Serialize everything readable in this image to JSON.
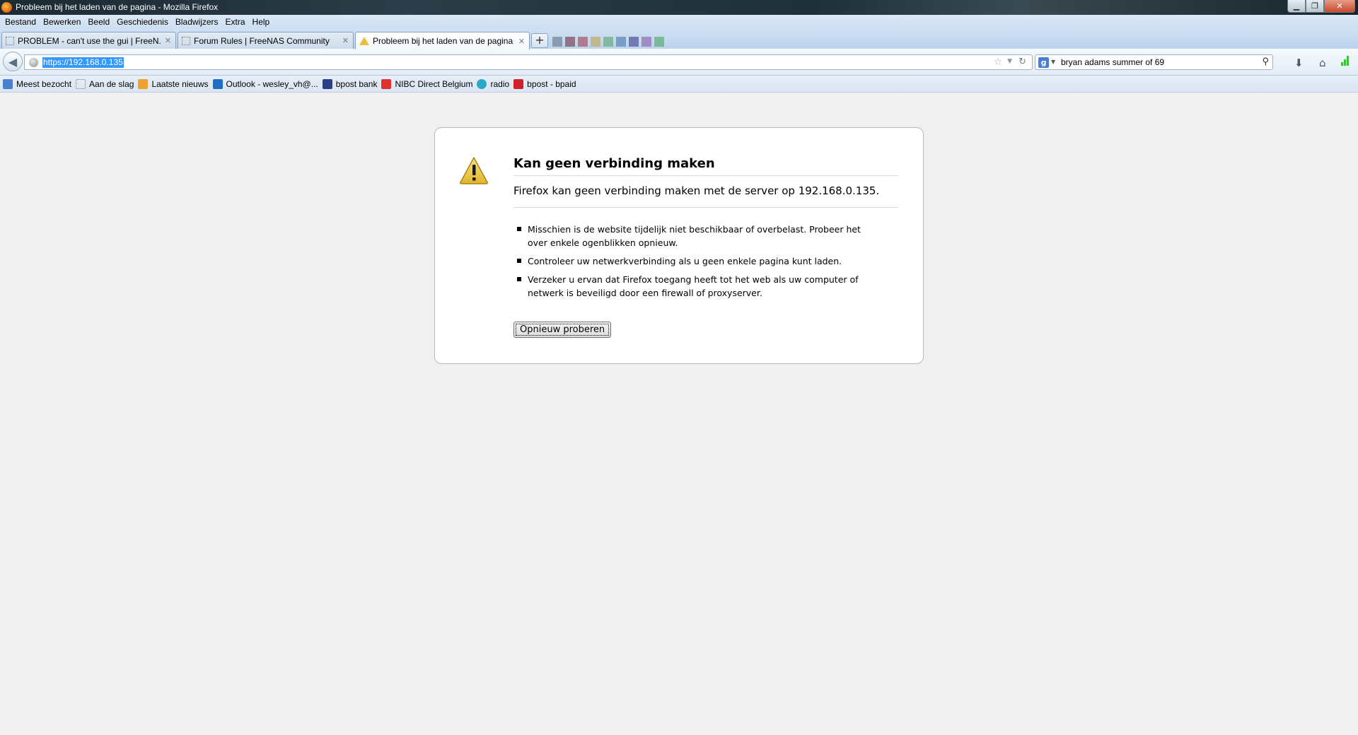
{
  "window": {
    "title": "Probleem bij het laden van de pagina - Mozilla Firefox"
  },
  "menubar": {
    "items": [
      "Bestand",
      "Bewerken",
      "Beeld",
      "Geschiedenis",
      "Bladwijzers",
      "Extra",
      "Help"
    ]
  },
  "tabs": [
    {
      "label": "PROBLEM - can't use the gui | FreeN...",
      "active": false
    },
    {
      "label": "Forum Rules | FreeNAS Community",
      "active": false
    },
    {
      "label": "Probleem bij het laden van de pagina",
      "active": true
    }
  ],
  "navbar": {
    "url": "https://192.168.0.135",
    "search_query": "bryan adams summer of 69"
  },
  "bookmarks": [
    {
      "label": "Meest bezocht",
      "icon": "most-visited-icon",
      "color": "#4a7fcf"
    },
    {
      "label": "Aan de slag",
      "icon": "page-icon",
      "color": "#ffffff"
    },
    {
      "label": "Laatste nieuws",
      "icon": "rss-icon",
      "color": "#f0a030"
    },
    {
      "label": "Outlook - wesley_vh@...",
      "icon": "outlook-icon",
      "color": "#1f6fc5"
    },
    {
      "label": "bpost bank",
      "icon": "bpost-bank-icon",
      "color": "#2b3f86"
    },
    {
      "label": "NIBC Direct Belgium",
      "icon": "nibc-icon",
      "color": "#e0322f"
    },
    {
      "label": "radio",
      "icon": "radio-icon",
      "color": "#2aa9c7"
    },
    {
      "label": "bpost - bpaid",
      "icon": "bpost-icon",
      "color": "#d0202a"
    }
  ],
  "error": {
    "title": "Kan geen verbinding maken",
    "description": "Firefox kan geen verbinding maken met de server op 192.168.0.135.",
    "items": [
      "Misschien is de website tijdelijk niet beschikbaar of overbelast. Probeer het over enkele ogenblikken opnieuw.",
      "Controleer uw netwerkverbinding als u geen enkele pagina kunt laden.",
      "Verzeker u ervan dat Firefox toegang heeft tot het web als uw computer of netwerk is beveiligd door een firewall of proxyserver."
    ],
    "retry_label": "Opnieuw proberen"
  }
}
